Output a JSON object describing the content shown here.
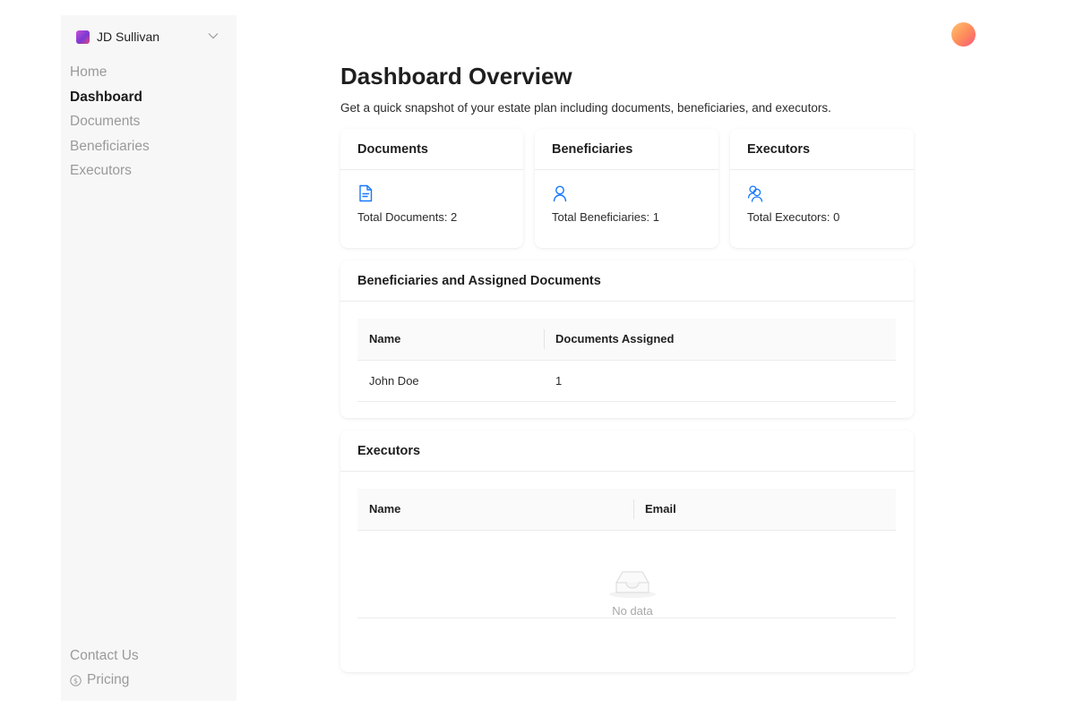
{
  "sidebar": {
    "account_name": "JD Sullivan",
    "nav": [
      "Home",
      "Dashboard",
      "Documents",
      "Beneficiaries",
      "Executors"
    ],
    "active_nav": "Dashboard",
    "footer": {
      "contact": "Contact Us",
      "pricing": "Pricing"
    }
  },
  "header": {
    "title": "Dashboard Overview",
    "subtitle": "Get a quick snapshot of your estate plan including documents, beneficiaries, and executors."
  },
  "stats": {
    "documents": {
      "title": "Documents",
      "text": "Total Documents: 2",
      "icon": "document-icon"
    },
    "beneficiaries": {
      "title": "Beneficiaries",
      "text": "Total Beneficiaries: 1",
      "icon": "user-icon"
    },
    "executors": {
      "title": "Executors",
      "text": "Total Executors: 0",
      "icon": "users-icon"
    }
  },
  "beneficiaries_table": {
    "title": "Beneficiaries and Assigned Documents",
    "columns": [
      "Name",
      "Documents Assigned"
    ],
    "rows": [
      [
        "John Doe",
        "1"
      ]
    ]
  },
  "executors_table": {
    "title": "Executors",
    "columns": [
      "Name",
      "Email"
    ],
    "rows": [],
    "empty_text": "No data"
  },
  "colors": {
    "accent": "#1677ff",
    "sidebar_bg": "#f7f7f7",
    "muted_text": "#9a9a9a"
  }
}
